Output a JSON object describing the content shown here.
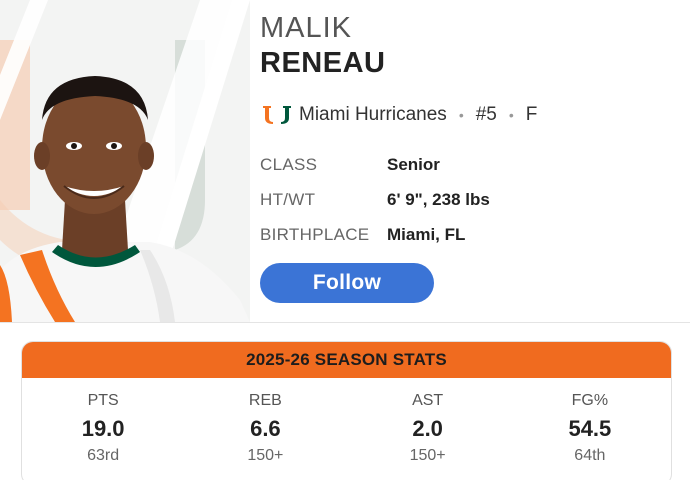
{
  "player": {
    "first_name": "MALIK",
    "last_name": "RENEAU",
    "team": "Miami Hurricanes",
    "number": "#5",
    "position": "F",
    "separator": "•"
  },
  "info": [
    {
      "label": "CLASS",
      "value": "Senior"
    },
    {
      "label": "HT/WT",
      "value": "6' 9\", 238 lbs"
    },
    {
      "label": "BIRTHPLACE",
      "value": "Miami, FL"
    }
  ],
  "actions": {
    "follow_label": "Follow"
  },
  "stats": {
    "title": "2025-26 SEASON STATS",
    "items": [
      {
        "label": "PTS",
        "value": "19.0",
        "rank": "63rd"
      },
      {
        "label": "REB",
        "value": "6.6",
        "rank": "150+"
      },
      {
        "label": "AST",
        "value": "2.0",
        "rank": "150+"
      },
      {
        "label": "FG%",
        "value": "54.5",
        "rank": "64th"
      }
    ]
  },
  "colors": {
    "accent_orange": "#f06b1f",
    "follow_blue": "#3b74d6",
    "team_green": "#00573c",
    "team_orange": "#f47321"
  },
  "icons": {
    "team_logo": "miami-u-logo",
    "player_photo": "player-headshot"
  }
}
